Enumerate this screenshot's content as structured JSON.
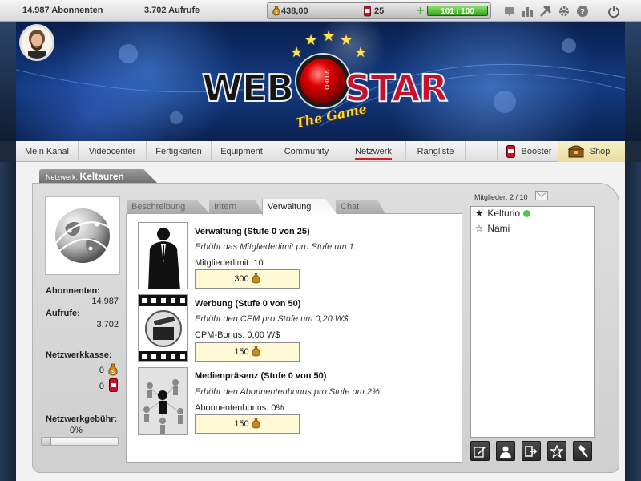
{
  "topbar": {
    "subscribers": "14.987 Abonnenten",
    "views": "3.702 Aufrufe",
    "gold": "438,00",
    "cans": "25",
    "energy_text": "101 / 100",
    "energy_fill": 1.0,
    "icons": [
      "download-icon",
      "ranking-icon",
      "tools-icon",
      "settings-icon",
      "help-icon",
      "power-icon"
    ]
  },
  "logo": {
    "web": "WEB",
    "star": "STAR",
    "lens_text": "VIDEO",
    "subtitle": "The Game"
  },
  "nav": {
    "items": [
      {
        "label": "Mein Kanal"
      },
      {
        "label": "Videocenter"
      },
      {
        "label": "Fertigkeiten"
      },
      {
        "label": "Equipment"
      },
      {
        "label": "Community"
      },
      {
        "label": "Netzwerk"
      },
      {
        "label": "Rangliste"
      },
      {
        "label": "Booster"
      },
      {
        "label": "Shop"
      }
    ]
  },
  "network": {
    "prefix": "Netzwerk:",
    "name": "Keltauren",
    "subscribers_label": "Abonnenten:",
    "subscribers_value": "14.987",
    "views_label": "Aufrufe:",
    "views_value": "3.702",
    "treasury_label": "Netzwerkkasse:",
    "treasury_gold": "0",
    "treasury_cans": "0",
    "fee_label": "Netzwerkgebühr:",
    "fee_value": "0%",
    "fee_fraction": 0.0
  },
  "subtabs": [
    {
      "label": "Beschreibung"
    },
    {
      "label": "Intern"
    },
    {
      "label": "Verwaltung"
    },
    {
      "label": "Chat"
    }
  ],
  "upgrades": [
    {
      "title": "Verwaltung (Stufe 0 von 25)",
      "desc": "Erhöht das Mitgliederlimit pro Stufe um 1.",
      "stat": "Mitgliederlimit: 10",
      "cost": "300",
      "icon": "businessman-icon"
    },
    {
      "title": "Werbung (Stufe 0 von 50)",
      "desc": "Erhöht den CPM pro Stufe um 0,20 W$.",
      "stat": "CPM-Bonus: 0,00 W$",
      "cost": "150",
      "icon": "film-clapper-icon"
    },
    {
      "title": "Medienpräsenz (Stufe 0 von 50)",
      "desc": "Erhöht den Abonnentenbonus pro Stufe um 2%.",
      "stat": "Abonnentenbonus: 0%",
      "cost": "150",
      "icon": "people-network-icon"
    }
  ],
  "members": {
    "label": "Mitglieder: 2 / 10",
    "list": [
      {
        "name": "Kelturio",
        "role": "leader",
        "online": true
      },
      {
        "name": "Nami",
        "role": "member",
        "online": false
      }
    ]
  },
  "colors": {
    "accent_red": "#c8102e",
    "energy_green": "#35a21e",
    "button_yellow": "#fff9d6",
    "online_green": "#4cc64c"
  }
}
